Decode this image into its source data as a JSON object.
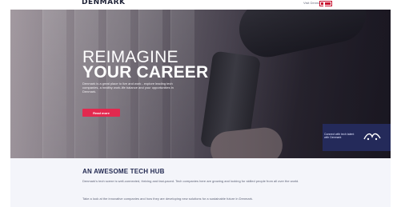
{
  "header": {
    "logo": "DENMARK",
    "top_link": "Visit Denmark",
    "flag_icon": "denmark-flag-icon"
  },
  "hero": {
    "title_line1": "REIMAGINE",
    "title_line2": "YOUR CAREER",
    "description": "Denmark is a great place to live and work - explore leading tech companies, a healthy work-life balance and your opportunities in Denmark.",
    "cta_label": "Read more",
    "badge_text": "Connect with tech talent with Denmark",
    "badge_logo_icon": "denmark-logo-icon"
  },
  "content": {
    "title": "AN AWESOME TECH HUB",
    "paragraph1": "Denmark's tech scene is well-connected, thriving and fast-paced. Tech companies here are growing and looking for skilled people from all over the world.",
    "paragraph2": "Take a look at the innovative companies and how they are developing new solutions for a sustainable future in Denmark."
  },
  "colors": {
    "accent": "#e2294f",
    "navy": "#232a52",
    "badge_bg": "#242a5a",
    "section_bg": "#f4f5fa"
  }
}
